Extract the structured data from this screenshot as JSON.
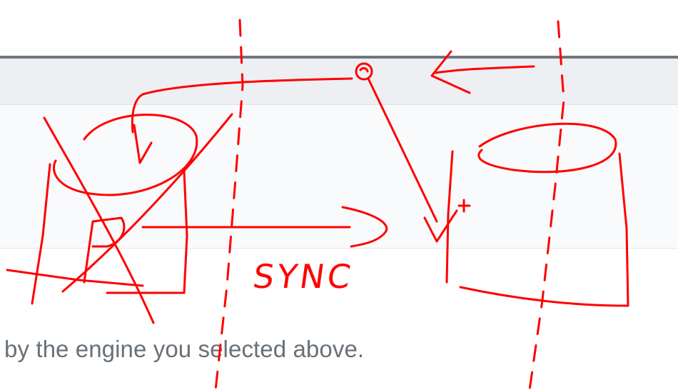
{
  "main": {
    "helper_text": "by the engine you selected above."
  },
  "annotation": {
    "label": "SYNC",
    "ink_color": "#ff0000",
    "drawings": [
      "crossed-out-database-icon",
      "database-icon",
      "sync-arrow-icon",
      "return-arrow-icon",
      "origin-dot-icon"
    ]
  },
  "colors": {
    "toolbar_border": "#6f7680",
    "toolbar_background": "#edeff2",
    "panel_background": "#f9fafb",
    "helper_text": "#687078"
  }
}
